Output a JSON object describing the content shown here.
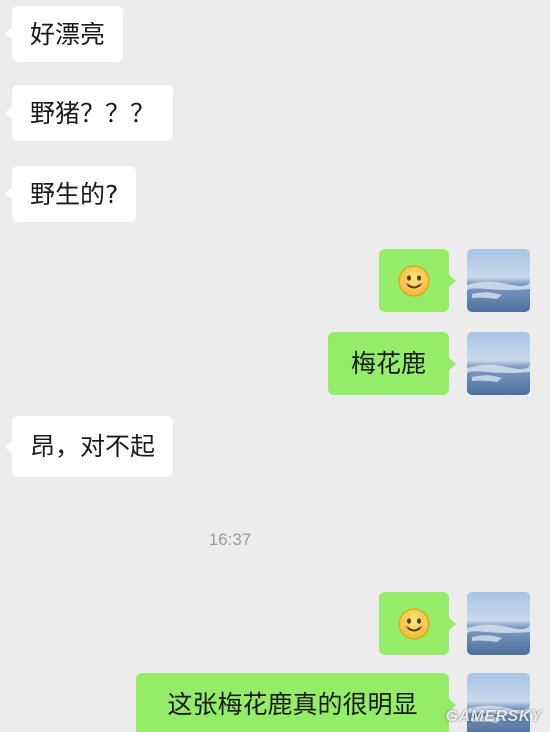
{
  "chat": {
    "messages": [
      {
        "side": "left",
        "text": "好漂亮"
      },
      {
        "side": "left",
        "text": "野猪？？？"
      },
      {
        "side": "left",
        "text": "野生的?"
      },
      {
        "side": "right",
        "emoji": "smile-emoji"
      },
      {
        "side": "right",
        "text": "梅花鹿"
      },
      {
        "side": "left",
        "text": "昂，对不起"
      },
      {
        "side": "right",
        "emoji": "smile-emoji"
      },
      {
        "side": "right",
        "text": "这张梅花鹿真的很明显"
      }
    ],
    "timestamp": "16:37"
  },
  "avatar_icon": "sea-landscape-avatar",
  "watermark": "GAMERSKY",
  "colors": {
    "background": "#ececec",
    "incoming_bubble": "#ffffff",
    "outgoing_bubble": "#95ec69",
    "timestamp": "#9a9a9a"
  }
}
